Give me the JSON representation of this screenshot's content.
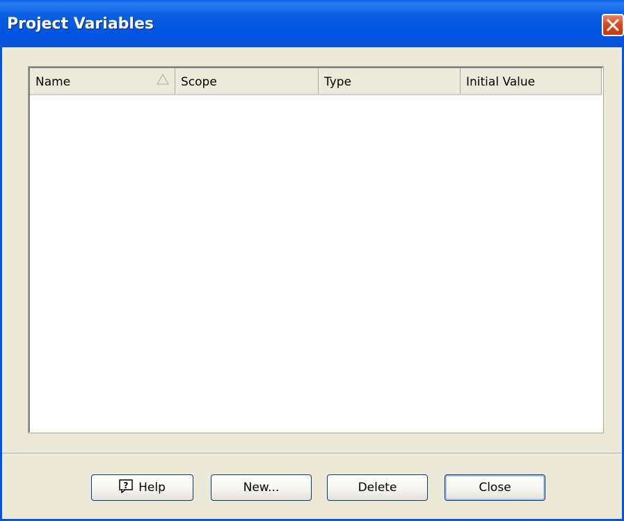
{
  "window": {
    "title": "Project Variables"
  },
  "list": {
    "columns": [
      {
        "label": "Name",
        "sorted": "ascending"
      },
      {
        "label": "Scope"
      },
      {
        "label": "Type"
      },
      {
        "label": "Initial Value"
      }
    ],
    "rows": []
  },
  "buttons": {
    "help": "Help",
    "new": "New...",
    "delete": "Delete",
    "close": "Close"
  },
  "icons": {
    "close": "close-x-icon",
    "sort": "sort-ascending-triangle-icon",
    "help": "help-question-icon"
  },
  "colors": {
    "titlebar": "#0054e3",
    "close_button": "#d9461c",
    "face": "#ece9d8"
  }
}
